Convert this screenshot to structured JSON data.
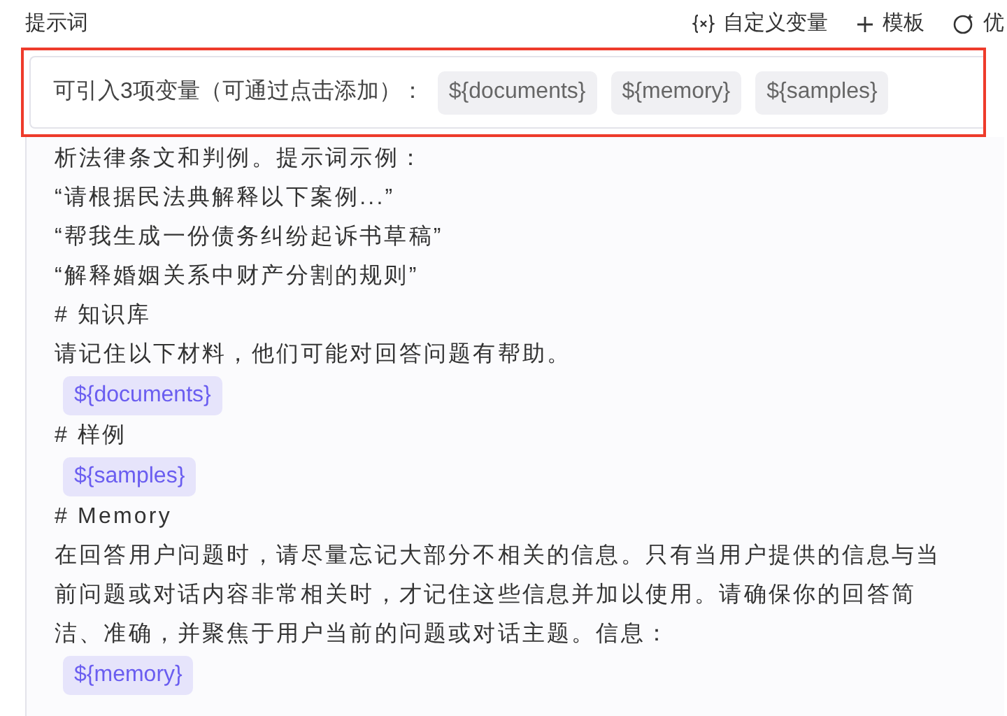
{
  "header": {
    "title": "提示词",
    "tools": [
      {
        "kind": "variable",
        "label": "自定义变量"
      },
      {
        "kind": "plus",
        "label": "模板"
      },
      {
        "kind": "ai",
        "label": "优"
      }
    ]
  },
  "variables_bar": {
    "label": "可引入3项变量（可通过点击添加）：",
    "chips": [
      "${documents}",
      "${memory}",
      "${samples}"
    ]
  },
  "body": [
    {
      "kind": "text",
      "text": "析法律条文和判例。提示词示例："
    },
    {
      "kind": "text",
      "text": "“请根据民法典解释以下案例...”"
    },
    {
      "kind": "text",
      "text": "“帮我生成一份债务纠纷起诉书草稿”"
    },
    {
      "kind": "text",
      "text": "“解释婚姻关系中财产分割的规则”"
    },
    {
      "kind": "text",
      "text": "# 知识库"
    },
    {
      "kind": "text",
      "text": "请记住以下材料，他们可能对回答问题有帮助。"
    },
    {
      "kind": "variable",
      "text": "${documents}"
    },
    {
      "kind": "text",
      "text": "# 样例"
    },
    {
      "kind": "variable",
      "text": "${samples}"
    },
    {
      "kind": "text",
      "text": "# Memory"
    },
    {
      "kind": "text",
      "text": "在回答用户问题时，请尽量忘记大部分不相关的信息。只有当用户提供的信息与当前问题或对话内容非常相关时，才记住这些信息并加以使用。请确保你的回答简洁、准确，并聚焦于用户当前的问题或对话主题。信息："
    },
    {
      "kind": "variable",
      "text": "${memory}"
    }
  ]
}
